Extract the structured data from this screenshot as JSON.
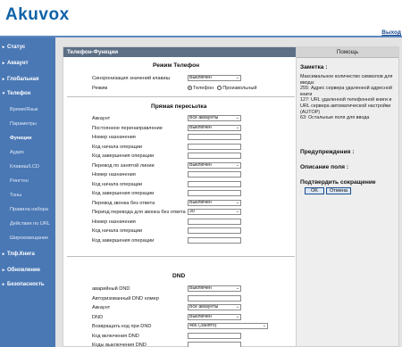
{
  "brand": {
    "logo": "Akuvox",
    "logout": "Выход"
  },
  "nav": [
    {
      "label": "Статус",
      "level": "top"
    },
    {
      "label": "Аккаунт",
      "level": "top"
    },
    {
      "label": "Глобальная",
      "level": "top"
    },
    {
      "label": "Телефон",
      "level": "top-open"
    },
    {
      "label": "Время/Язык",
      "level": "sub"
    },
    {
      "label": "Параметры",
      "level": "sub"
    },
    {
      "label": "Функции",
      "level": "sub-active"
    },
    {
      "label": "Аудио",
      "level": "sub"
    },
    {
      "label": "Клавиш/LCD",
      "level": "sub"
    },
    {
      "label": "Рингтон",
      "level": "sub"
    },
    {
      "label": "Тоны",
      "level": "sub"
    },
    {
      "label": "Правила набора",
      "level": "sub"
    },
    {
      "label": "Действия по URL",
      "level": "sub"
    },
    {
      "label": "Широковещание",
      "level": "sub"
    },
    {
      "label": "Тлф.Книга",
      "level": "top"
    },
    {
      "label": "Обновление",
      "level": "top"
    },
    {
      "label": "Безопасность",
      "level": "top"
    }
  ],
  "main": {
    "title": "Телефон-Функции",
    "mode_section": {
      "title": "Режим   Телефон",
      "rows": [
        {
          "label": "Синхронизация значений клавиш",
          "value": "Выключен"
        },
        {
          "label": "Режим",
          "radio": [
            "Телефон",
            "Произвольный"
          ],
          "selected": 0
        }
      ]
    },
    "forward_section": {
      "title": "Прямая пересылка",
      "rows": [
        {
          "label": "Аккаунт",
          "type": "select",
          "value": "Все аккаунты"
        },
        {
          "label": "Постоянное перенаправление",
          "type": "select",
          "value": "Выключен"
        },
        {
          "label": "Номер назначения",
          "type": "input",
          "value": ""
        },
        {
          "label": "Код начала операции",
          "type": "input",
          "value": ""
        },
        {
          "label": "Код завершения операции",
          "type": "input",
          "value": ""
        },
        {
          "label": "Перевод по занятой линии",
          "type": "select",
          "value": "Выключен"
        },
        {
          "label": "Номер назначения",
          "type": "input",
          "value": ""
        },
        {
          "label": "Код начала операции",
          "type": "input",
          "value": ""
        },
        {
          "label": "Код завершения операции",
          "type": "input",
          "value": ""
        },
        {
          "label": "Перевод звонка без ответа",
          "type": "select",
          "value": "Выключен"
        },
        {
          "label": "Период перевода для звонка без ответа",
          "type": "select",
          "value": "30"
        },
        {
          "label": "Номер назначения",
          "type": "input",
          "value": ""
        },
        {
          "label": "Код начала операции",
          "type": "input",
          "value": ""
        },
        {
          "label": "Код завершения операции",
          "type": "input",
          "value": ""
        }
      ]
    },
    "dnd_section": {
      "title": "DND",
      "rows": [
        {
          "label": "аварийный DND",
          "type": "select",
          "value": "Выключен"
        },
        {
          "label": "Авторизованный DND номер",
          "type": "input",
          "value": ""
        },
        {
          "label": "Аккаунт",
          "type": "select",
          "value": "Все аккаунты"
        },
        {
          "label": "DND",
          "type": "select",
          "value": "Выключен"
        },
        {
          "label": "Возвращать код при DND",
          "type": "select-wide",
          "value": "486 (Занято)"
        },
        {
          "label": "Код включения DND",
          "type": "input",
          "value": ""
        },
        {
          "label": "Коды выключения DND",
          "type": "input",
          "value": ""
        }
      ]
    }
  },
  "help": {
    "button": "Помощь",
    "note_title": "Заметка :",
    "note_text": "Максимальное количество символов для ввода:\n255: Адрес сервера удаленной адресной книги\n127: URL удаленной телефонной книги и URL сервера автоматической настройки (AUTOP)\n63: Остальные поля для ввода",
    "warn_title": "Предупреждения :",
    "desc_title": "Описание поля :",
    "confirm_title": "Подтвердить сокращение",
    "ok": "OK",
    "cancel": "Отмена"
  }
}
